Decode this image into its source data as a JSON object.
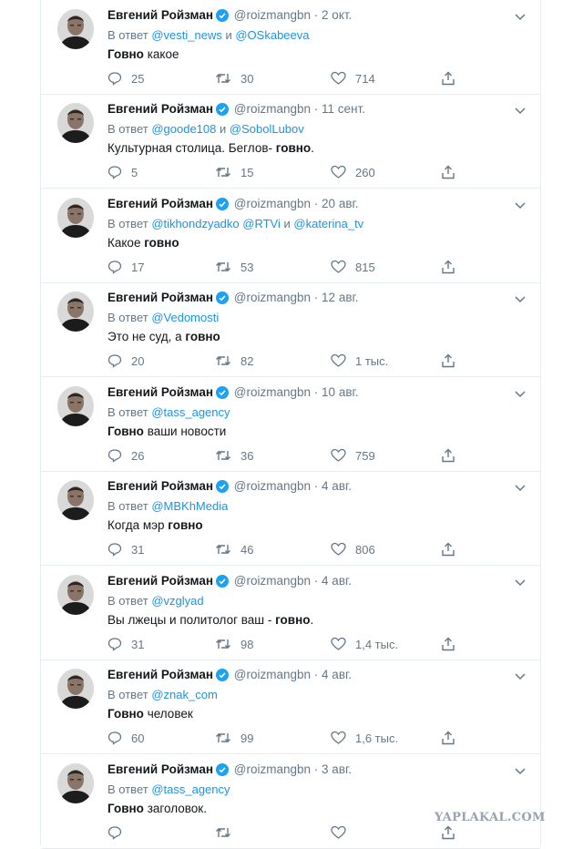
{
  "tweets": [
    {
      "name": "Евгений Ройзман",
      "handle": "@roizmangbn",
      "sep": "·",
      "date": "2 окт.",
      "reply_prefix": "В ответ",
      "mention1": "@vesti_news",
      "reply_and": "и",
      "mention2": "@OSkabeeva",
      "text_pre": "",
      "text_bold": "Говно",
      "text_post": " какое",
      "replies": "25",
      "retweets": "30",
      "likes": "714"
    },
    {
      "name": "Евгений Ройзман",
      "handle": "@roizmangbn",
      "sep": "·",
      "date": "11 сент.",
      "reply_prefix": "В ответ",
      "mention1": "@goode108",
      "reply_and": "и",
      "mention2": "@SobolLubov",
      "text_pre": "Культурная столица. Беглов- ",
      "text_bold": "говно",
      "text_post": ".",
      "replies": "5",
      "retweets": "15",
      "likes": "260"
    },
    {
      "name": "Евгений Ройзман",
      "handle": "@roizmangbn",
      "sep": "·",
      "date": "20 авг.",
      "reply_prefix": "В ответ",
      "mention1": "@tikhondzyadko @RTVi",
      "reply_and": "и",
      "mention2": "@katerina_tv",
      "text_pre": "Какое ",
      "text_bold": "говно",
      "text_post": "",
      "replies": "17",
      "retweets": "53",
      "likes": "815"
    },
    {
      "name": "Евгений Ройзман",
      "handle": "@roizmangbn",
      "sep": "·",
      "date": "12 авг.",
      "reply_prefix": "В ответ",
      "mention1": "@Vedomosti",
      "reply_and": "",
      "mention2": "",
      "text_pre": "Это не суд, а ",
      "text_bold": "говно",
      "text_post": "",
      "replies": "20",
      "retweets": "82",
      "likes": "1 тыс."
    },
    {
      "name": "Евгений Ройзман",
      "handle": "@roizmangbn",
      "sep": "·",
      "date": "10 авг.",
      "reply_prefix": "В ответ",
      "mention1": "@tass_agency",
      "reply_and": "",
      "mention2": "",
      "text_pre": "",
      "text_bold": "Говно",
      "text_post": " ваши новости",
      "replies": "26",
      "retweets": "36",
      "likes": "759"
    },
    {
      "name": "Евгений Ройзман",
      "handle": "@roizmangbn",
      "sep": "·",
      "date": "4 авг.",
      "reply_prefix": "В ответ",
      "mention1": "@MBKhMedia",
      "reply_and": "",
      "mention2": "",
      "text_pre": "Когда мэр ",
      "text_bold": "говно",
      "text_post": "",
      "replies": "31",
      "retweets": "46",
      "likes": "806"
    },
    {
      "name": "Евгений Ройзман",
      "handle": "@roizmangbn",
      "sep": "·",
      "date": "4 авг.",
      "reply_prefix": "В ответ",
      "mention1": "@vzglyad",
      "reply_and": "",
      "mention2": "",
      "text_pre": "Вы лжецы и политолог ваш - ",
      "text_bold": "говно",
      "text_post": ".",
      "replies": "31",
      "retweets": "98",
      "likes": "1,4 тыс."
    },
    {
      "name": "Евгений Ройзман",
      "handle": "@roizmangbn",
      "sep": "·",
      "date": "4 авг.",
      "reply_prefix": "В ответ",
      "mention1": "@znak_com",
      "reply_and": "",
      "mention2": "",
      "text_pre": "",
      "text_bold": "Говно",
      "text_post": " человек",
      "replies": "60",
      "retweets": "99",
      "likes": "1,6 тыс."
    },
    {
      "name": "Евгений Ройзман",
      "handle": "@roizmangbn",
      "sep": "·",
      "date": "3 авг.",
      "reply_prefix": "В ответ",
      "mention1": "@tass_agency",
      "reply_and": "",
      "mention2": "",
      "text_pre": "",
      "text_bold": "Говно",
      "text_post": " заголовок.",
      "replies": "",
      "retweets": "",
      "likes": ""
    }
  ],
  "icons": {
    "verified": "verified-badge-icon",
    "reply": "reply-icon",
    "retweet": "retweet-icon",
    "like": "heart-icon",
    "share": "share-icon",
    "menu": "chevron-down-icon"
  },
  "colors": {
    "link": "#1b95e0",
    "secondary": "#657786",
    "text": "#14171a",
    "verified": "#1da1f2"
  },
  "watermark": "YAPLAKAL.COM"
}
